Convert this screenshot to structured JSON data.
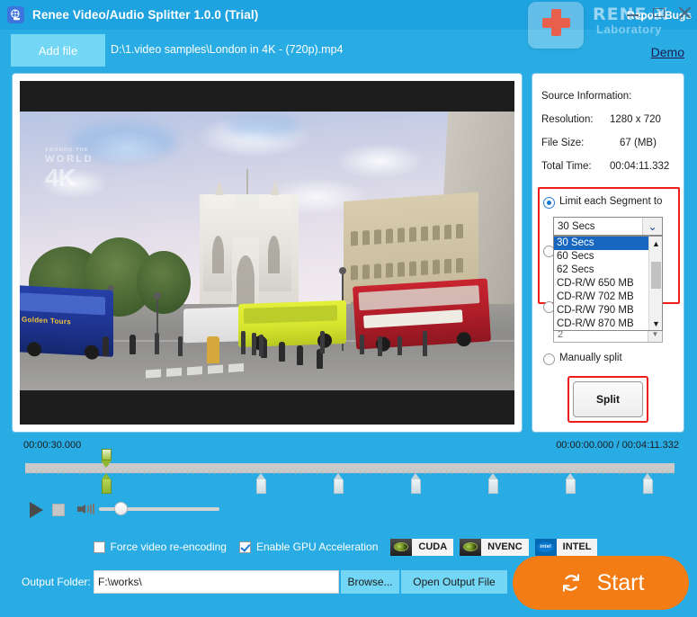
{
  "window": {
    "title": "Renee Video/Audio Splitter 1.0.0 (Trial)",
    "app_icon": "film-reel-icon",
    "report_bugs_label": "Report Bugs",
    "brand_main": "RENE.X",
    "brand_sub": "Laboratory",
    "minimize_icon": "minimize-icon",
    "maximize_icon": "maximize-icon",
    "close_icon": "close-icon",
    "accent_color": "#1fa2e0",
    "body_color": "#29ace4"
  },
  "toolbar": {
    "add_file_label": "Add file",
    "file_path": "D:\\1.video samples\\London in 4K - (720p).mp4",
    "demo_label": "Demo"
  },
  "preview": {
    "watermark_top": "AROUND THE",
    "watermark_world": "WORLD",
    "watermark_4k": "4K",
    "bus_blue_text": "Golden Tours"
  },
  "source_info": {
    "heading": "Source Information:",
    "resolution_label": "Resolution:",
    "resolution_value": "1280 x 720",
    "filesize_label": "File Size:",
    "filesize_value": "67 (MB)",
    "totaltime_label": "Total Time:",
    "totaltime_value": "00:04:11.332"
  },
  "split_options": {
    "limit_label": "Limit each Segment to",
    "limit_selected": true,
    "combo_value": "30 Secs",
    "combo_arrow_icon": "chevron-down-icon",
    "dropdown_open": true,
    "dropdown_items": [
      "30 Secs",
      "60 Secs",
      "62 Secs",
      "CD-R/W 650 MB",
      "CD-R/W 702 MB",
      "CD-R/W 790 MB",
      "CD-R/W 870 MB"
    ],
    "dropdown_selected_index": 0,
    "scroll_up_icon": "caret-up-icon",
    "scroll_down_icon": "caret-down-icon",
    "spinner_value": "2",
    "spinner_icon": "spinner-down-icon",
    "manual_label": "Manually split",
    "manual_selected": false,
    "split_button_label": "Split",
    "highlight_color": "#f01c1c"
  },
  "timeline": {
    "left_time": "00:00:30.000",
    "right_time": "00:00:00.000 / 00:04:11.332",
    "playhead_percent": 12.3,
    "markers": [
      {
        "percent": 12.3,
        "active": true
      },
      {
        "percent": 36.5,
        "active": false
      },
      {
        "percent": 48.6,
        "active": false
      },
      {
        "percent": 60.5,
        "active": false
      },
      {
        "percent": 72.4,
        "active": false
      },
      {
        "percent": 84.4,
        "active": false
      },
      {
        "percent": 96.3,
        "active": false
      },
      {
        "percent": 108.0,
        "active": false
      }
    ],
    "play_icon": "play-icon",
    "stop_icon": "stop-icon",
    "volume_icon": "volume-icon",
    "volume_percent": 13
  },
  "footer": {
    "force_reencode_label": "Force video re-encoding",
    "force_reencode_checked": false,
    "gpu_accel_label": "Enable GPU Acceleration",
    "gpu_accel_checked": true,
    "gpu_badges": [
      {
        "name": "CUDA",
        "logo": "nvidia-eye-icon"
      },
      {
        "name": "NVENC",
        "logo": "nvidia-eye-icon"
      },
      {
        "name": "INTEL",
        "logo": "intel-logo-icon"
      }
    ],
    "intel_logo_text": "intel",
    "output_label": "Output Folder:",
    "output_value": "F:\\works\\",
    "browse_label": "Browse...",
    "open_output_label": "Open Output File",
    "start_label": "Start",
    "start_icon": "refresh-sync-icon",
    "start_color": "#f47c14"
  }
}
